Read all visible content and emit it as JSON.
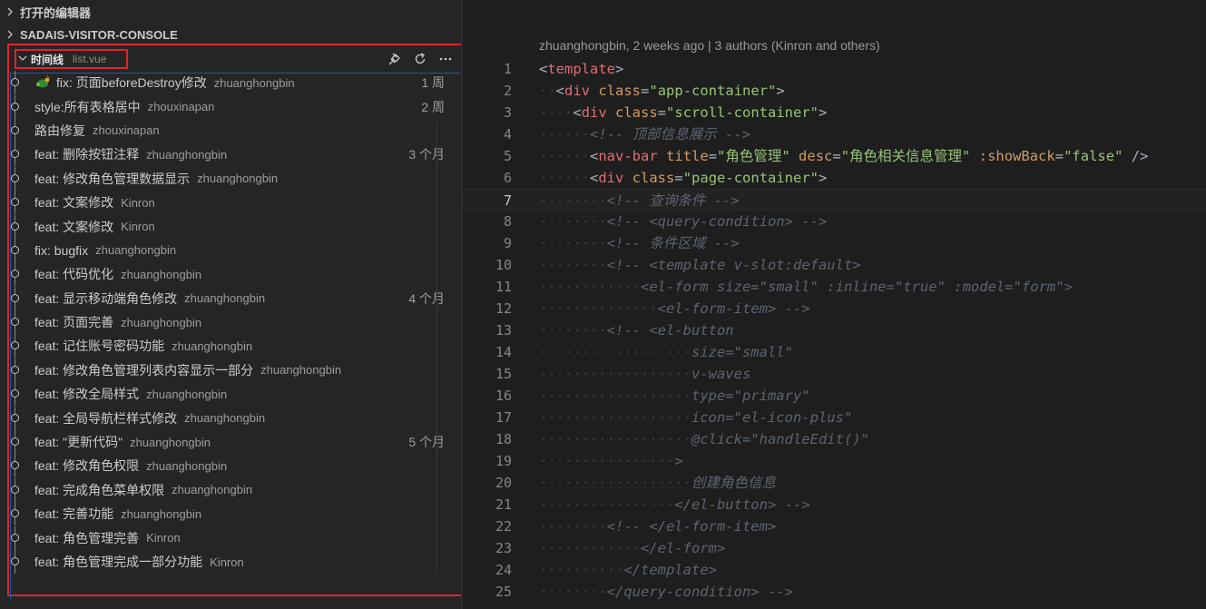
{
  "sidebar": {
    "open_editors": "打开的编辑器",
    "project": "SADAIS-VISITOR-CONSOLE",
    "timeline": {
      "title": "时间线",
      "file": "list.vue",
      "entries": [
        {
          "message": "fix: 页面beforeDestroy修改",
          "author": "zhuanghongbin",
          "time": "1 周",
          "icon": "bug-icon"
        },
        {
          "message": "style:所有表格居中",
          "author": "zhouxinapan",
          "time": "2 周"
        },
        {
          "message": "路由修复",
          "author": "zhouxinapan",
          "time": ""
        },
        {
          "message": "feat: 删除按钮注释",
          "author": "zhuanghongbin",
          "time": "3 个月"
        },
        {
          "message": "feat: 修改角色管理数据显示",
          "author": "zhuanghongbin",
          "time": ""
        },
        {
          "message": "feat: 文案修改",
          "author": "Kinron",
          "time": ""
        },
        {
          "message": "feat: 文案修改",
          "author": "Kinron",
          "time": ""
        },
        {
          "message": "fix: bugfix",
          "author": "zhuanghongbin",
          "time": ""
        },
        {
          "message": "feat: 代码优化",
          "author": "zhuanghongbin",
          "time": ""
        },
        {
          "message": "feat: 显示移动端角色修改",
          "author": "zhuanghongbin",
          "time": "4 个月"
        },
        {
          "message": "feat: 页面完善",
          "author": "zhuanghongbin",
          "time": ""
        },
        {
          "message": "feat: 记住账号密码功能",
          "author": "zhuanghongbin",
          "time": ""
        },
        {
          "message": "feat: 修改角色管理列表内容显示一部分",
          "author": "zhuanghongbin",
          "time": ""
        },
        {
          "message": "feat: 修改全局样式",
          "author": "zhuanghongbin",
          "time": ""
        },
        {
          "message": "feat: 全局导航栏样式修改",
          "author": "zhuanghongbin",
          "time": ""
        },
        {
          "message": "feat: \"更新代码\"",
          "author": "zhuanghongbin",
          "time": "5 个月"
        },
        {
          "message": "feat: 修改角色权限",
          "author": "zhuanghongbin",
          "time": ""
        },
        {
          "message": "feat: 完成角色菜单权限",
          "author": "zhuanghongbin",
          "time": ""
        },
        {
          "message": "feat: 完善功能",
          "author": "zhuanghongbin",
          "time": ""
        },
        {
          "message": "feat: 角色管理完善",
          "author": "Kinron",
          "time": ""
        },
        {
          "message": "feat: 角色管理完成一部分功能",
          "author": "Kinron",
          "time": ""
        }
      ]
    }
  },
  "editor": {
    "blame": "zhuanghongbin, 2 weeks ago | 3 authors (Kinron and others)",
    "current_line": 7,
    "lines": [
      {
        "n": "1",
        "indent": 0,
        "parts": [
          [
            "punc",
            "<"
          ],
          [
            "tag",
            "template"
          ],
          [
            "punc",
            ">"
          ]
        ]
      },
      {
        "n": "2",
        "indent": 1,
        "parts": [
          [
            "punc",
            "<"
          ],
          [
            "tag",
            "div"
          ],
          [
            "punc",
            " "
          ],
          [
            "attr",
            "class"
          ],
          [
            "punc",
            "="
          ],
          [
            "str",
            "\"app-container\""
          ],
          [
            "punc",
            ">"
          ]
        ]
      },
      {
        "n": "3",
        "indent": 2,
        "parts": [
          [
            "punc",
            "<"
          ],
          [
            "tag",
            "div"
          ],
          [
            "punc",
            " "
          ],
          [
            "attr",
            "class"
          ],
          [
            "punc",
            "="
          ],
          [
            "str",
            "\"scroll-container\""
          ],
          [
            "punc",
            ">"
          ]
        ]
      },
      {
        "n": "4",
        "indent": 3,
        "parts": [
          [
            "cmt",
            "<!-- 顶部信息展示 -->"
          ]
        ]
      },
      {
        "n": "5",
        "indent": 3,
        "parts": [
          [
            "punc",
            "<"
          ],
          [
            "tag",
            "nav-bar"
          ],
          [
            "punc",
            " "
          ],
          [
            "attr",
            "title"
          ],
          [
            "punc",
            "="
          ],
          [
            "str",
            "\"角色管理\""
          ],
          [
            "punc",
            " "
          ],
          [
            "attr",
            "desc"
          ],
          [
            "punc",
            "="
          ],
          [
            "str",
            "\"角色相关信息管理\""
          ],
          [
            "punc",
            " "
          ],
          [
            "attr",
            ":showBack"
          ],
          [
            "punc",
            "="
          ],
          [
            "str",
            "\"false\""
          ],
          [
            "punc",
            " />"
          ]
        ]
      },
      {
        "n": "6",
        "indent": 3,
        "parts": [
          [
            "punc",
            "<"
          ],
          [
            "tag",
            "div"
          ],
          [
            "punc",
            " "
          ],
          [
            "attr",
            "class"
          ],
          [
            "punc",
            "="
          ],
          [
            "str",
            "\"page-container\""
          ],
          [
            "punc",
            ">"
          ]
        ]
      },
      {
        "n": "7",
        "indent": 4,
        "parts": [
          [
            "cmt",
            "<!-- 查询条件 -->"
          ]
        ]
      },
      {
        "n": "8",
        "indent": 4,
        "parts": [
          [
            "cmt",
            "<!-- <query-condition> -->"
          ]
        ]
      },
      {
        "n": "9",
        "indent": 4,
        "parts": [
          [
            "cmt",
            "<!-- 条件区域 -->"
          ]
        ]
      },
      {
        "n": "10",
        "indent": 4,
        "parts": [
          [
            "cmt",
            "<!-- <template v-slot:default>"
          ]
        ]
      },
      {
        "n": "11",
        "indent": 6,
        "parts": [
          [
            "cmt",
            "<el-form size=\"small\" :inline=\"true\" :model=\"form\">"
          ]
        ]
      },
      {
        "n": "12",
        "indent": 7,
        "parts": [
          [
            "cmt",
            "<el-form-item> -->"
          ]
        ]
      },
      {
        "n": "13",
        "indent": 4,
        "parts": [
          [
            "cmt",
            "<!-- <el-button"
          ]
        ]
      },
      {
        "n": "14",
        "indent": 9,
        "parts": [
          [
            "cmt",
            "size=\"small\""
          ]
        ]
      },
      {
        "n": "15",
        "indent": 9,
        "parts": [
          [
            "cmt",
            "v-waves"
          ]
        ]
      },
      {
        "n": "16",
        "indent": 9,
        "parts": [
          [
            "cmt",
            "type=\"primary\""
          ]
        ]
      },
      {
        "n": "17",
        "indent": 9,
        "parts": [
          [
            "cmt",
            "icon=\"el-icon-plus\""
          ]
        ]
      },
      {
        "n": "18",
        "indent": 9,
        "parts": [
          [
            "cmt",
            "@click=\"handleEdit()\""
          ]
        ]
      },
      {
        "n": "19",
        "indent": 8,
        "parts": [
          [
            "cmt",
            ">"
          ]
        ]
      },
      {
        "n": "20",
        "indent": 9,
        "parts": [
          [
            "cmt",
            "创建角色信息"
          ]
        ]
      },
      {
        "n": "21",
        "indent": 8,
        "parts": [
          [
            "cmt",
            "</el-button> -->"
          ]
        ]
      },
      {
        "n": "22",
        "indent": 4,
        "parts": [
          [
            "cmt",
            "<!-- </el-form-item>"
          ]
        ]
      },
      {
        "n": "23",
        "indent": 6,
        "parts": [
          [
            "cmt",
            "</el-form>"
          ]
        ]
      },
      {
        "n": "24",
        "indent": 5,
        "parts": [
          [
            "cmt",
            "</template>"
          ]
        ]
      },
      {
        "n": "25",
        "indent": 4,
        "parts": [
          [
            "cmt",
            "</query-condition> -->"
          ]
        ]
      }
    ]
  }
}
